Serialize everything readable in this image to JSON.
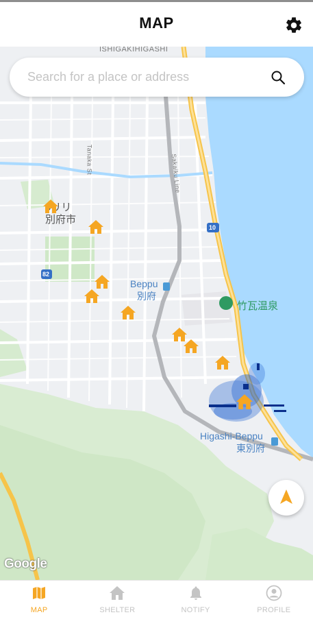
{
  "header": {
    "title": "MAP",
    "settings_icon": "gear-icon"
  },
  "search": {
    "placeholder": "Search for a place or address",
    "icon": "search-icon"
  },
  "map": {
    "labels": {
      "district": "ISHIGAKIHIGASHI",
      "street_a": "Tanaka St",
      "street_b": "Sakaiku Line",
      "route_a": "10",
      "route_b": "82",
      "beppu_en": "Beppu",
      "beppu_jp": "別府",
      "poi": "竹瓦温泉",
      "city_a": "oリリ",
      "city_b": "別府市",
      "higashi_en": "Higashi-Beppu",
      "higashi_jp": "東別府"
    },
    "attribution": "Google",
    "colors": {
      "shelter": "#f5a623",
      "water": "#aadaff",
      "park": "#cfe8c7",
      "highway": "#f6c44a"
    }
  },
  "locate_button": {
    "icon": "navigation-arrow-icon"
  },
  "nav": {
    "items": [
      {
        "label": "MAP",
        "icon": "map-icon",
        "active": true
      },
      {
        "label": "SHELTER",
        "icon": "house-icon",
        "active": false
      },
      {
        "label": "NOTIFY",
        "icon": "bell-icon",
        "active": false
      },
      {
        "label": "PROFILE",
        "icon": "user-icon",
        "active": false
      }
    ],
    "active_color": "#f5a623",
    "inactive_color": "#c4c4c4"
  }
}
